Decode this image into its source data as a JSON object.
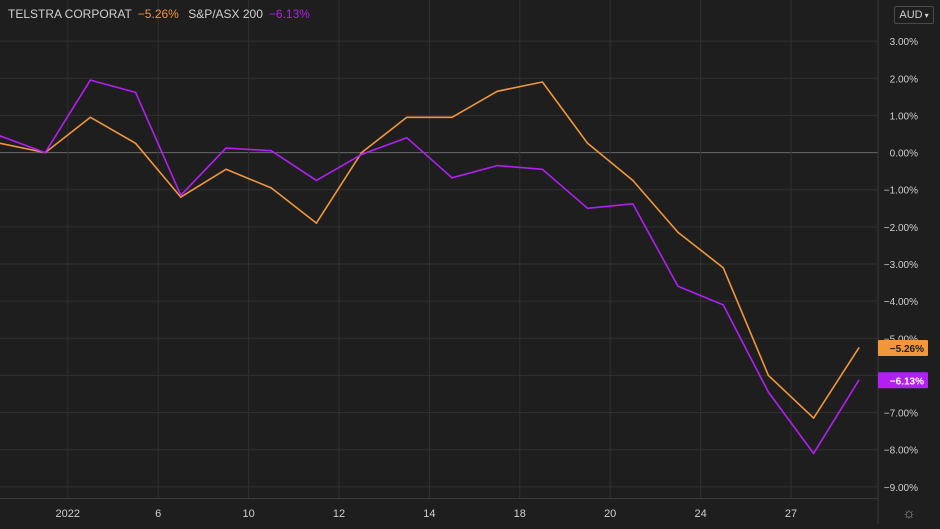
{
  "legend": {
    "series1_name": "TELSTRA CORPORAT",
    "series1_change": "−5.26%",
    "series2_name": "S&P/ASX 200",
    "series2_change": "−6.13%"
  },
  "currency": {
    "label": "AUD"
  },
  "icons": {
    "currency_dropdown": "chevron-down-icon",
    "settings": "gear-icon"
  },
  "colors": {
    "background": "#1e1e1e",
    "grid": "#303030",
    "zero_line": "#6a6a6a",
    "axis_text": "#cfcfcf",
    "series1": "#f0963c",
    "series2": "#b21ff2"
  },
  "chart_data": {
    "type": "line",
    "x_ticks": [
      "2022",
      "6",
      "10",
      "12",
      "14",
      "18",
      "20",
      "24",
      "27"
    ],
    "y_ticks": [
      "3.00%",
      "2.00%",
      "1.00%",
      "0.00%",
      "−1.00%",
      "−2.00%",
      "−3.00%",
      "−4.00%",
      "−5.00%",
      "−6.00%",
      "−7.00%",
      "−8.00%",
      "−9.00%"
    ],
    "ylim": [
      -9.3,
      3.3
    ],
    "series": [
      {
        "name": "TELSTRA CORPORAT",
        "color": "#f0963c",
        "last_value_label": "−5.26%",
        "values": [
          0.25,
          0.0,
          0.95,
          0.25,
          -1.2,
          -0.45,
          -0.95,
          -1.9,
          0.0,
          0.95,
          0.95,
          1.65,
          1.9,
          0.25,
          -0.75,
          -2.15,
          -3.1,
          -6.0,
          -7.15,
          -5.26
        ]
      },
      {
        "name": "S&P/ASX 200",
        "color": "#b21ff2",
        "last_value_label": "−6.13%",
        "values": [
          0.45,
          0.0,
          1.95,
          1.62,
          -1.15,
          0.12,
          0.05,
          -0.75,
          -0.05,
          0.4,
          -0.68,
          -0.35,
          -0.45,
          -1.5,
          -1.38,
          -3.6,
          -4.1,
          -6.45,
          -8.1,
          -6.13
        ]
      }
    ]
  }
}
